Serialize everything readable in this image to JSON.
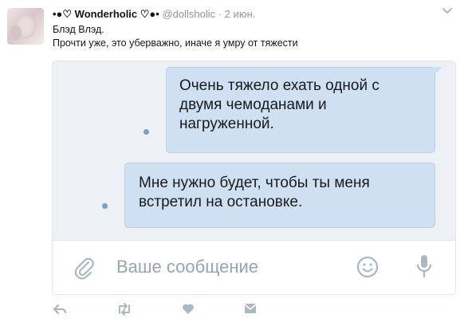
{
  "tweet": {
    "display_name": "•●♡ Wonderholic ♡●•",
    "handle": "@dollsholic",
    "separator": "·",
    "date": "2 июн.",
    "text_line1": "Блэд Влэд.",
    "text_line2": "Прочти уже, это уберважно,  иначе я умру от тяжести"
  },
  "chat": {
    "messages": [
      {
        "line1": "Очень тяжело ехать одной с",
        "line2": "двумя чемоданами и",
        "line3": "нагруженной."
      },
      {
        "line1": "Мне нужно будет,  чтобы ты меня",
        "line2": "встретил на остановке."
      }
    ],
    "composer_placeholder": "Ваше сообщение"
  },
  "colors": {
    "bubble": "#cfe0f3",
    "chat_background": "#edf0f5",
    "icon_gray": "#aab8c2",
    "meta_gray": "#8899a6"
  },
  "icons": {
    "caret": "chevron-down-icon",
    "attach": "paperclip-icon",
    "emoji": "smiley-icon",
    "voice": "microphone-icon",
    "reply": "reply-icon",
    "retweet": "retweet-icon",
    "like": "heart-icon",
    "dm": "envelope-icon"
  }
}
